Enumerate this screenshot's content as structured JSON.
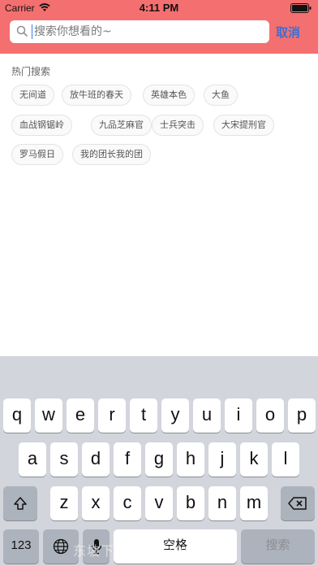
{
  "status_bar": {
    "carrier": "Carrier",
    "time": "4:11 PM"
  },
  "search": {
    "placeholder": "搜索你想看的~",
    "cancel_label": "取消"
  },
  "hot_search": {
    "title": "热门搜索",
    "tags": [
      "无间道",
      "放牛班的春天",
      "英雄本色",
      "大鱼",
      "血战钢锯岭",
      "九品芝麻官",
      "士兵突击",
      "大宋提刑官",
      "罗马假日",
      "我的团长我的团"
    ]
  },
  "keyboard": {
    "row1": [
      "q",
      "w",
      "e",
      "r",
      "t",
      "y",
      "u",
      "i",
      "o",
      "p"
    ],
    "row2": [
      "a",
      "s",
      "d",
      "f",
      "g",
      "h",
      "j",
      "k",
      "l"
    ],
    "row3": [
      "z",
      "x",
      "c",
      "v",
      "b",
      "n",
      "m"
    ],
    "numbers_label": "123",
    "space_label": "空格",
    "search_label": "搜索",
    "shift_icon": "shift-icon",
    "delete_icon": "delete-icon",
    "globe_icon": "globe-icon",
    "mic_icon": "microphone-icon"
  },
  "watermark": "东坡下载 • NEOQH.COM",
  "colors": {
    "header": "#f46f6f",
    "cancel": "#3d6fd1",
    "keyboard_bg": "#d2d5db"
  }
}
